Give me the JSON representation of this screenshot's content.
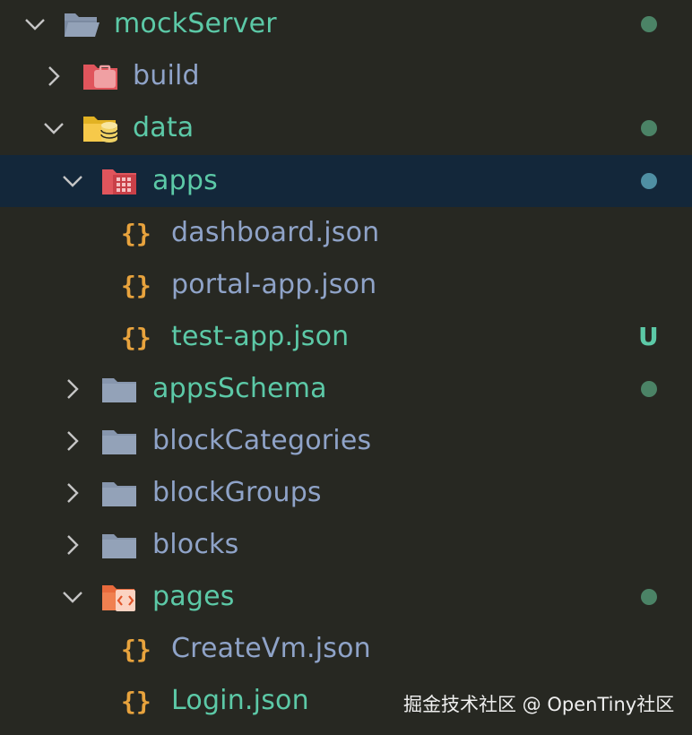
{
  "colors": {
    "background": "#272822",
    "selected_row": "#13273a",
    "modified_text": "#5cc9a7",
    "unchanged_text": "#8fa3c8",
    "json_icon": "#e8a33d",
    "modified_dot": "#4b8366",
    "selected_dot": "#4f8fa3",
    "untracked_badge": "#5cc9a7"
  },
  "tree": {
    "mockServer": {
      "label": "mockServer",
      "icon": "folder-open-icon",
      "status": "modified"
    },
    "build": {
      "label": "build",
      "icon": "build-folder-icon"
    },
    "data": {
      "label": "data",
      "icon": "database-folder-icon",
      "status": "modified"
    },
    "apps": {
      "label": "apps",
      "icon": "apps-folder-icon",
      "status": "modified"
    },
    "dashboard_json": {
      "label": "dashboard.json",
      "icon": "json-icon"
    },
    "portal_app_json": {
      "label": "portal-app.json",
      "icon": "json-icon"
    },
    "test_app_json": {
      "label": "test-app.json",
      "icon": "json-icon",
      "badge": "U"
    },
    "appsSchema": {
      "label": "appsSchema",
      "icon": "folder-icon",
      "status": "modified"
    },
    "blockCategories": {
      "label": "blockCategories",
      "icon": "folder-icon"
    },
    "blockGroups": {
      "label": "blockGroups",
      "icon": "folder-icon"
    },
    "blocks": {
      "label": "blocks",
      "icon": "folder-icon"
    },
    "pages": {
      "label": "pages",
      "icon": "pages-folder-icon",
      "status": "modified"
    },
    "CreateVm_json": {
      "label": "CreateVm.json",
      "icon": "json-icon"
    },
    "Login_json": {
      "label": "Login.json",
      "icon": "json-icon"
    }
  },
  "watermark": "掘金技术社区 @ OpenTiny社区"
}
